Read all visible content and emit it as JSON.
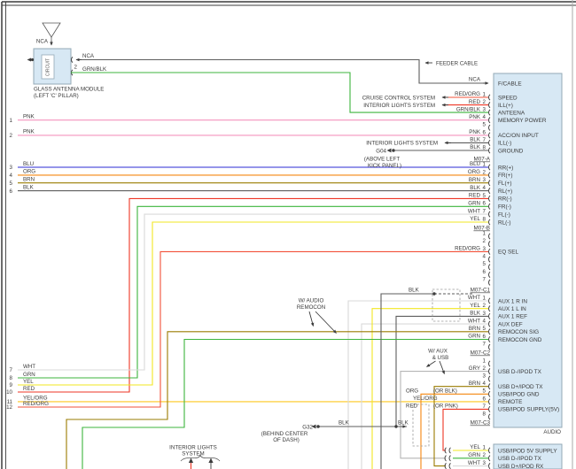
{
  "colors": {
    "PNK": "#f493be",
    "BLU": "#2b2bd6",
    "ORG": "#f5860f",
    "BRN": "#9a7b00",
    "BLK": "#5e5e5e",
    "RED": "#ee3524",
    "GRN": "#3cb53c",
    "WHT": "#d9d9d9",
    "YEL": "#f2e722",
    "GRY": "#b5b5b5",
    "RED/ORG": "#f25038",
    "YEL/ORG": "#fec81e",
    "GRN/BLK": "#3cb53c",
    "NCA": "#5e5e5e",
    "box_fill": "#d7e8f4",
    "box_border": "#93a9b6",
    "text": "#3a3a3a"
  },
  "module": {
    "antenna_wire": "NCA",
    "circuit": "CIRCUIT",
    "name1": "GLASS ANTENNA MODULE",
    "name2": "(LEFT 'C' PILLAR)",
    "pin2": "2"
  },
  "wire_tags": {
    "nca": "NCA",
    "grnblk": "GRN/BLK",
    "nca2": "NCA",
    "blk_shield": "BLK",
    "blk_g32a": "BLK",
    "blk_g32b": "BLK"
  },
  "annotations": {
    "feeder_cable": "FEEDER CABLE",
    "cruise": "CRUISE CONTROL SYSTEM",
    "interior": "INTERIOR LIGHTS SYSTEM",
    "interior_b1": "INTERIOR LIGHTS",
    "interior_b2": "SYSTEM",
    "w_audio_remocon_1": "W/ AUDIO",
    "w_audio_remocon_2": "REMOCON",
    "w_aux_usb_1": "W/ AUX",
    "w_aux_usb_2": "& USB",
    "audio_caption": "AUDIO",
    "g04": {
      "label": "G04",
      "loc1": "(ABOVE LEFT",
      "loc2": "KICK PANEL)"
    },
    "g32": {
      "label": "G32",
      "loc1": "(BEHIND CENTER",
      "loc2": "OF DASH)"
    }
  },
  "left_wires": [
    {
      "num": "1",
      "label": "PNK"
    },
    {
      "num": "2",
      "label": "PNK"
    },
    {
      "num": "3",
      "label": "BLU"
    },
    {
      "num": "4",
      "label": "ORG"
    },
    {
      "num": "5",
      "label": "BRN"
    },
    {
      "num": "6",
      "label": "BLK"
    },
    {
      "num": "7",
      "label": "WHT"
    },
    {
      "num": "8",
      "label": "GRN"
    },
    {
      "num": "9",
      "label": "YEL"
    },
    {
      "num": "10",
      "label": "RED"
    },
    {
      "num": "11",
      "label": "YEL/ORG"
    },
    {
      "num": "12",
      "label": "RED/ORG"
    }
  ],
  "audio_box": {
    "fcable": "F/CABLE",
    "sections": [
      {
        "label": "",
        "pins": [
          {
            "n": "1",
            "wire": "RED/ORG",
            "name": "SPEED"
          },
          {
            "n": "2",
            "wire": "RED",
            "name": "ILL(+)"
          },
          {
            "n": "3",
            "wire": "GRN/BLK",
            "name": "ANTEENA"
          },
          {
            "n": "4",
            "wire": "PNK",
            "name": "MEMORY POWER"
          },
          {
            "n": "5",
            "wire": "",
            "name": ""
          },
          {
            "n": "6",
            "wire": "PNK",
            "name": "ACC/ON INPUT"
          },
          {
            "n": "7",
            "wire": "BLK",
            "name": "ILL(-)"
          },
          {
            "n": "8",
            "wire": "BLK",
            "name": "GROUND"
          }
        ]
      },
      {
        "label": "M07-A",
        "pins": [
          {
            "n": "1",
            "wire": "BLU",
            "name": "RR(+)"
          },
          {
            "n": "2",
            "wire": "ORG",
            "name": "FR(+)"
          },
          {
            "n": "3",
            "wire": "BRN",
            "name": "FL(+)"
          },
          {
            "n": "4",
            "wire": "BLK",
            "name": "RL(+)"
          },
          {
            "n": "5",
            "wire": "RED",
            "name": "RR(-)"
          },
          {
            "n": "6",
            "wire": "GRN",
            "name": "FR(-)"
          },
          {
            "n": "7",
            "wire": "WHT",
            "name": "FL(-)"
          },
          {
            "n": "8",
            "wire": "YEL",
            "name": "RL(-)"
          }
        ]
      },
      {
        "label": "M07-B",
        "pins": [
          {
            "n": "1",
            "wire": "",
            "name": ""
          },
          {
            "n": "2",
            "wire": "",
            "name": ""
          },
          {
            "n": "3",
            "wire": "RED/ORG",
            "name": "EQ SEL"
          },
          {
            "n": "4",
            "wire": "",
            "name": ""
          },
          {
            "n": "5",
            "wire": "",
            "name": ""
          },
          {
            "n": "6",
            "wire": "",
            "name": ""
          },
          {
            "n": "7",
            "wire": "",
            "name": ""
          }
        ]
      },
      {
        "label": "M07-C1",
        "pins": [
          {
            "n": "1",
            "wire": "WHT",
            "name": "AUX 1 R IN"
          },
          {
            "n": "2",
            "wire": "YEL",
            "name": "AUX 1 L IN"
          },
          {
            "n": "3",
            "wire": "BLK",
            "name": "AUX 1 REF"
          },
          {
            "n": "4",
            "wire": "WHT",
            "name": "AUX DEF"
          },
          {
            "n": "5",
            "wire": "BRN",
            "name": "REMOCON SIG"
          },
          {
            "n": "6",
            "wire": "GRN",
            "name": "REMOCON GND"
          },
          {
            "n": "7",
            "wire": "",
            "name": ""
          }
        ]
      },
      {
        "label": "M07-C2",
        "pins": [
          {
            "n": "1",
            "wire": "",
            "name": ""
          },
          {
            "n": "2",
            "wire": "GRY",
            "name": "USB D-/IPOD TX"
          },
          {
            "n": "3",
            "wire": "",
            "name": ""
          },
          {
            "n": "4",
            "wire": "BRN",
            "name": "USB D+/IPOD TX"
          },
          {
            "n": "5",
            "wire": "ORG",
            "note": "(OR BLK)",
            "name": "USB/IPOD GND"
          },
          {
            "n": "6",
            "wire": "YEL/ORG",
            "name": "REMOTE"
          },
          {
            "n": "7",
            "wire": "RED",
            "note": "(OR PNK)",
            "name": "USB/IPOD SUPPLY(5V)"
          },
          {
            "n": "8",
            "wire": "",
            "name": ""
          }
        ]
      },
      {
        "label": "M07-C3",
        "pins": []
      }
    ]
  },
  "usb_box": {
    "pins": [
      {
        "n": "1",
        "wire": "YEL",
        "name": "USB/IPOD 5V SUPPLY"
      },
      {
        "n": "2",
        "wire": "GRN",
        "name": "USB D-/IPOD TX"
      },
      {
        "n": "3",
        "wire": "WHT",
        "name": "USB D+/IPOD RX"
      }
    ]
  }
}
